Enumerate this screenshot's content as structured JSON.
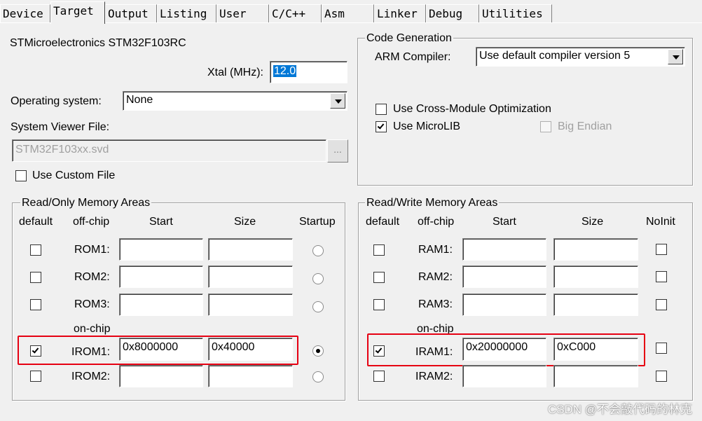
{
  "tabs": [
    "Device",
    "Target",
    "Output",
    "Listing",
    "User",
    "C/C++",
    "Asm",
    "Linker",
    "Debug",
    "Utilities"
  ],
  "active_tab": "Target",
  "device_name": "STMicroelectronics STM32F103RC",
  "xtal": {
    "label": "Xtal (MHz):",
    "value": "12.0"
  },
  "os": {
    "label": "Operating system:",
    "value": "None"
  },
  "svd": {
    "label": "System Viewer File:",
    "value": "STM32F103xx.svd",
    "browse": "...",
    "custom_label": "Use Custom File"
  },
  "codegen": {
    "title": "Code Generation",
    "compiler_label": "ARM Compiler:",
    "compiler_value": "Use default compiler version 5",
    "cross_module": "Use Cross-Module Optimization",
    "microlib": "Use MicroLIB",
    "big_endian": "Big Endian"
  },
  "ro": {
    "title": "Read/Only Memory Areas",
    "headers": {
      "default": "default",
      "offchip": "off-chip",
      "start": "Start",
      "size": "Size",
      "startup": "Startup"
    },
    "onchip_label": "on-chip",
    "rows": [
      {
        "name": "ROM1:",
        "start": "",
        "size": ""
      },
      {
        "name": "ROM2:",
        "start": "",
        "size": ""
      },
      {
        "name": "ROM3:",
        "start": "",
        "size": ""
      },
      {
        "name": "IROM1:",
        "start": "0x8000000",
        "size": "0x40000"
      },
      {
        "name": "IROM2:",
        "start": "",
        "size": ""
      }
    ]
  },
  "rw": {
    "title": "Read/Write Memory Areas",
    "headers": {
      "default": "default",
      "offchip": "off-chip",
      "start": "Start",
      "size": "Size",
      "noinit": "NoInit"
    },
    "onchip_label": "on-chip",
    "rows": [
      {
        "name": "RAM1:",
        "start": "",
        "size": ""
      },
      {
        "name": "RAM2:",
        "start": "",
        "size": ""
      },
      {
        "name": "RAM3:",
        "start": "",
        "size": ""
      },
      {
        "name": "IRAM1:",
        "start": "0x20000000",
        "size": "0xC000"
      },
      {
        "name": "IRAM2:",
        "start": "",
        "size": ""
      }
    ]
  },
  "watermark": "CSDN @不会敲代码的林克",
  "colors": {
    "highlight": "#e60012",
    "selection": "#0078d7"
  }
}
